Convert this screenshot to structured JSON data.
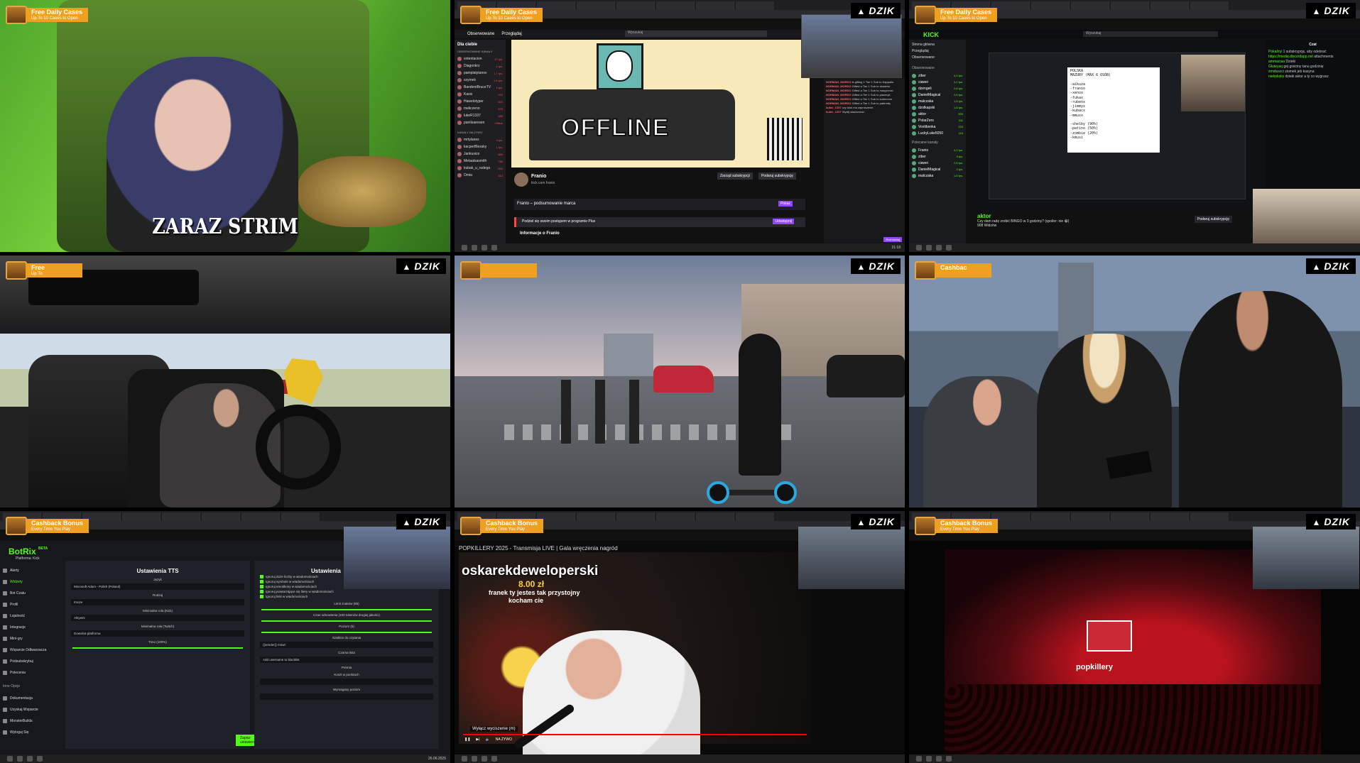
{
  "overlay": {
    "dzik_label": "DZIK",
    "promo_daily_title": "Free Daily Cases",
    "promo_daily_sub": "Up To 10 Cases to Open",
    "promo_free_title": "Free",
    "promo_free_sub": "Up To",
    "promo_cashbac_title": "Cashbac",
    "promo_cashback_title": "Cashback Bonus",
    "promo_cashback_sub": "Every Time You Play",
    "colors": {
      "promo_orange": "#f0a020",
      "kick_green": "#53fc18",
      "twitch_purple": "#9147ff"
    }
  },
  "tile1": {
    "caption": "ZARAZ STRIM"
  },
  "tile2": {
    "nav": [
      "Obserwowane",
      "Przeglądaj"
    ],
    "search_placeholder": "Wyszukaj",
    "side_title": "Dla ciebie",
    "side_subtitle": "OBSERWOWANE KANAŁY",
    "channels": [
      {
        "name": "xntentacion",
        "viewers": "17 tys."
      },
      {
        "name": "Diagonkrz",
        "viewers": "1 tys."
      },
      {
        "name": "pamplatytanov",
        "viewers": "1,7 tys."
      },
      {
        "name": "szymek",
        "viewers": "1,5 tys."
      },
      {
        "name": "BandentBruceTV",
        "viewers": "1 tys."
      },
      {
        "name": "Kasix",
        "viewers": "972"
      },
      {
        "name": "Hawelotyper",
        "viewers": "821"
      },
      {
        "name": "meliczeno",
        "viewers": "579"
      },
      {
        "name": "lukeR1337",
        "viewers": "489"
      },
      {
        "name": "paniIsaevsen",
        "viewers": "Offline"
      }
    ],
    "side_live_title": "KANAŁY NA ŻYWO",
    "live_channels": [
      {
        "name": "mrtylanex",
        "viewers": "3 tys."
      },
      {
        "name": "kacperBlexsky",
        "viewers": "1 tys."
      },
      {
        "name": "Jankusice",
        "viewers": "884"
      },
      {
        "name": "Metaalsasmith",
        "viewers": "782"
      },
      {
        "name": "kubak_u_rudego",
        "viewers": "594"
      },
      {
        "name": "Omia",
        "viewers": "412"
      }
    ],
    "offline_word": "OFFLINE",
    "channel_name": "Franio",
    "channel_sub": "kick.com franio",
    "follow_btn": "Zarząd subskrypcji",
    "sub_btn": "Podaruj subskrypcję",
    "about_text": "Franio – podsumowanie marca",
    "about_btn": "Pokaż",
    "plus_text": "Podziel się swoim postępem w programie Plus",
    "plus_btn": "Udostępnij",
    "info": "Informacje o Franio",
    "chat_lines": [
      {
        "user": "NORMAN_MORDO",
        "text": "is gifting 1 Tier 1 Sub to Kappalin"
      },
      {
        "user": "NORMAN_MORDO",
        "text": "Gifted a Tier 1 Sub to xkadzior"
      },
      {
        "user": "NORMAN_MORDO",
        "text": "Gifted a Tier 1 Sub to masynecki"
      },
      {
        "user": "NORMAN_MORDO",
        "text": "Gifted a Tier 1 Sub to paweryk"
      },
      {
        "user": "NORMAN_MORDO",
        "text": "Gifted a Tier 1 Sub to kubenmm"
      },
      {
        "user": "NORMAN_MORDO",
        "text": "Gifted a Tier 1 Sub to pateretty"
      },
      {
        "user": "kubix_1337",
        "text": "czy ktoś ma zaproszenie"
      },
      {
        "user": "kubix_1337",
        "text": "Wyślij wiadomość"
      }
    ],
    "chat_send": "Rozmawiaj"
  },
  "tile3": {
    "logo": "KICK",
    "search_placeholder": "Wyszukaj",
    "nav": [
      "Strona główna",
      "Przeglądaj",
      "Obserwowane"
    ],
    "side_title": "Obserwowane",
    "channels": [
      {
        "name": "ziber",
        "viewers": "4,3 tys."
      },
      {
        "name": "ciawei",
        "viewers": "3,1 tys."
      },
      {
        "name": "dzengeli",
        "viewers": "2,8 tys."
      },
      {
        "name": "DanielMagical",
        "viewers": "2,6 tys."
      },
      {
        "name": "malczaka",
        "viewers": "1,5 tys."
      },
      {
        "name": "dzolkapski",
        "viewers": "1,6 tys."
      },
      {
        "name": "aktor",
        "viewers": "920"
      },
      {
        "name": "PolarZero",
        "viewers": "311"
      },
      {
        "name": "Voxtibonka",
        "viewers": "223"
      },
      {
        "name": "LuckyLuke5050",
        "viewers": "116"
      }
    ],
    "recommended_title": "Polecane kanały",
    "recommended": [
      {
        "name": "Franio",
        "viewers": "4,3 tys."
      },
      {
        "name": "ziber",
        "viewers": "3 tys."
      },
      {
        "name": "ciawei",
        "viewers": "2,8 tys."
      },
      {
        "name": "DanielMagical",
        "viewers": "2 tys."
      },
      {
        "name": "malczaka",
        "viewers": "1,6 tys."
      }
    ],
    "notepad_lines": [
      "POLSKA",
      "MAZURY (MAX 6 OSÓB)",
      "",
      "-aikuza",
      "-franio",
      "-xenox",
      "-fukax",
      "-rubenx",
      "-jimmyx",
      "-kubacx",
      "-mmusx",
      "",
      "-shelby (90%)",
      "-patino (50%)",
      "-zombie (20%)",
      "-kmusi"
    ],
    "streamer_name": "aktor",
    "streamer_title": "Czy dam radę zrobić BINGO w 3 godziny? (spoiler: nie 😁)",
    "streamer_viewers": "908 Widzów",
    "sub_btn": "Podaruj subskrypcję",
    "chat_title": "Czat",
    "chat_lines": [
      {
        "user": "Pokažný",
        "text": "1 subskrypcję, aby odebrać"
      },
      {
        "user": "https://media.discordapp.net",
        "text": "attachments"
      },
      {
        "user": "ammaciaa",
        "text": "Dzieki"
      },
      {
        "user": "Gluteyaq",
        "text": "gej gościny tanu godzinię"
      },
      {
        "user": "zmiduszci",
        "text": "ziomek jeb kasyna"
      },
      {
        "user": "niekokoks",
        "text": "dzieki aktor a ty co wygrasz"
      }
    ]
  },
  "tile7": {
    "app_name": "BotRix",
    "app_badge": "BETA",
    "platform": "Platforma: Kick",
    "menu": [
      "Alerty",
      "Widżety",
      "Bot Czatu",
      "Profil",
      "Lojalność",
      "Integracje",
      "Mini-gry",
      "Wsparcie Odtwarzacza",
      "Podsubskrybuj",
      "Polecenia"
    ],
    "other_title": "Inne Opcje",
    "other": [
      "Dokumentacja",
      "Uzyskaj Wsparcie",
      "MonsterBuilds",
      "Wyloguj Się"
    ],
    "tts_title": "Ustawienia TTS",
    "tts_labels": [
      "Język",
      "Rodzaj",
      "Minimalna rola (Kick)",
      "Minimalna rola (Twitch)",
      "Tono (100%)"
    ],
    "tts_values": [
      "Microsoft Adam - Polish (Poland)",
      "Imoze",
      "Aktywni",
      "Dowolna platforma"
    ],
    "settings_title": "Ustawienia",
    "checks": [
      "Ignoruj duże liczby w wiadomościach",
      "Ignoruj symbole w wiadomościach",
      "Ignoruj emotikony w wiadomościach",
      "Ignoruj powtarzające się litery w wiadomościach",
      "Ignoruj linki w wiadomościach"
    ],
    "settings_labels": [
      "Limit znaków (85)",
      "Czas odnowienia (100 tokenów drugiej jakości)",
      "Poziom (5)",
      "Szablon do czytania",
      "Czarna lista",
      "Premia",
      "Koszt w punktach",
      "Wymagany poziom"
    ],
    "settings_values": [
      "{{sender}} mówi:",
      "Add username to blacklist"
    ],
    "save_btn": "Zapisz ustawienia"
  },
  "tile8": {
    "video_title": "POPKILLERY 2025 - Transmisja LIVE | Gala wręczenia nagród",
    "donor_name": "oskarekdeweloperski",
    "donor_amount": "8.00 zł",
    "donor_message_1": "franek ty jestes tak przystojny",
    "donor_message_2": "kocham cie",
    "subtitle_toggle": "Wyłącz wyciszenie (m)",
    "live_label": "NA ŻYWO"
  },
  "tile9": {
    "brand": "popkillery"
  },
  "taskbar": {
    "clock_time": "21:18",
    "clock_date": "26.06.2025"
  }
}
